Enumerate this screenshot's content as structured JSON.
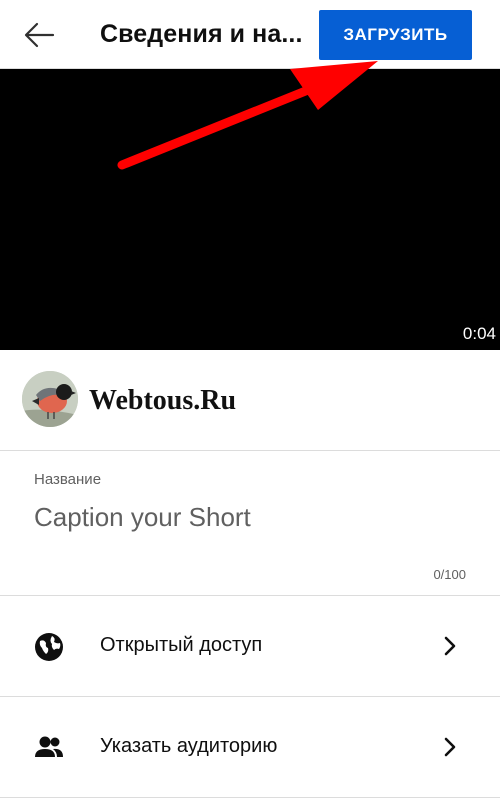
{
  "header": {
    "title": "Сведения и на...",
    "upload_label": "ЗАГРУЗИТЬ",
    "back_icon": "arrow-back-icon",
    "upload_color": "#065fd4"
  },
  "video": {
    "duration": "0:04",
    "annotation_color": "#ff0000"
  },
  "channel": {
    "avatar": "bird-avatar",
    "watermark": "Webtous.Ru"
  },
  "title_field": {
    "label": "Название",
    "placeholder": "Caption your Short",
    "value": "",
    "counter": "0/100"
  },
  "options": [
    {
      "label": "Открытый доступ",
      "icon": "globe-icon",
      "chevron": "chevron-right-icon"
    },
    {
      "label": "Указать аудиторию",
      "icon": "people-icon",
      "chevron": "chevron-right-icon"
    }
  ]
}
